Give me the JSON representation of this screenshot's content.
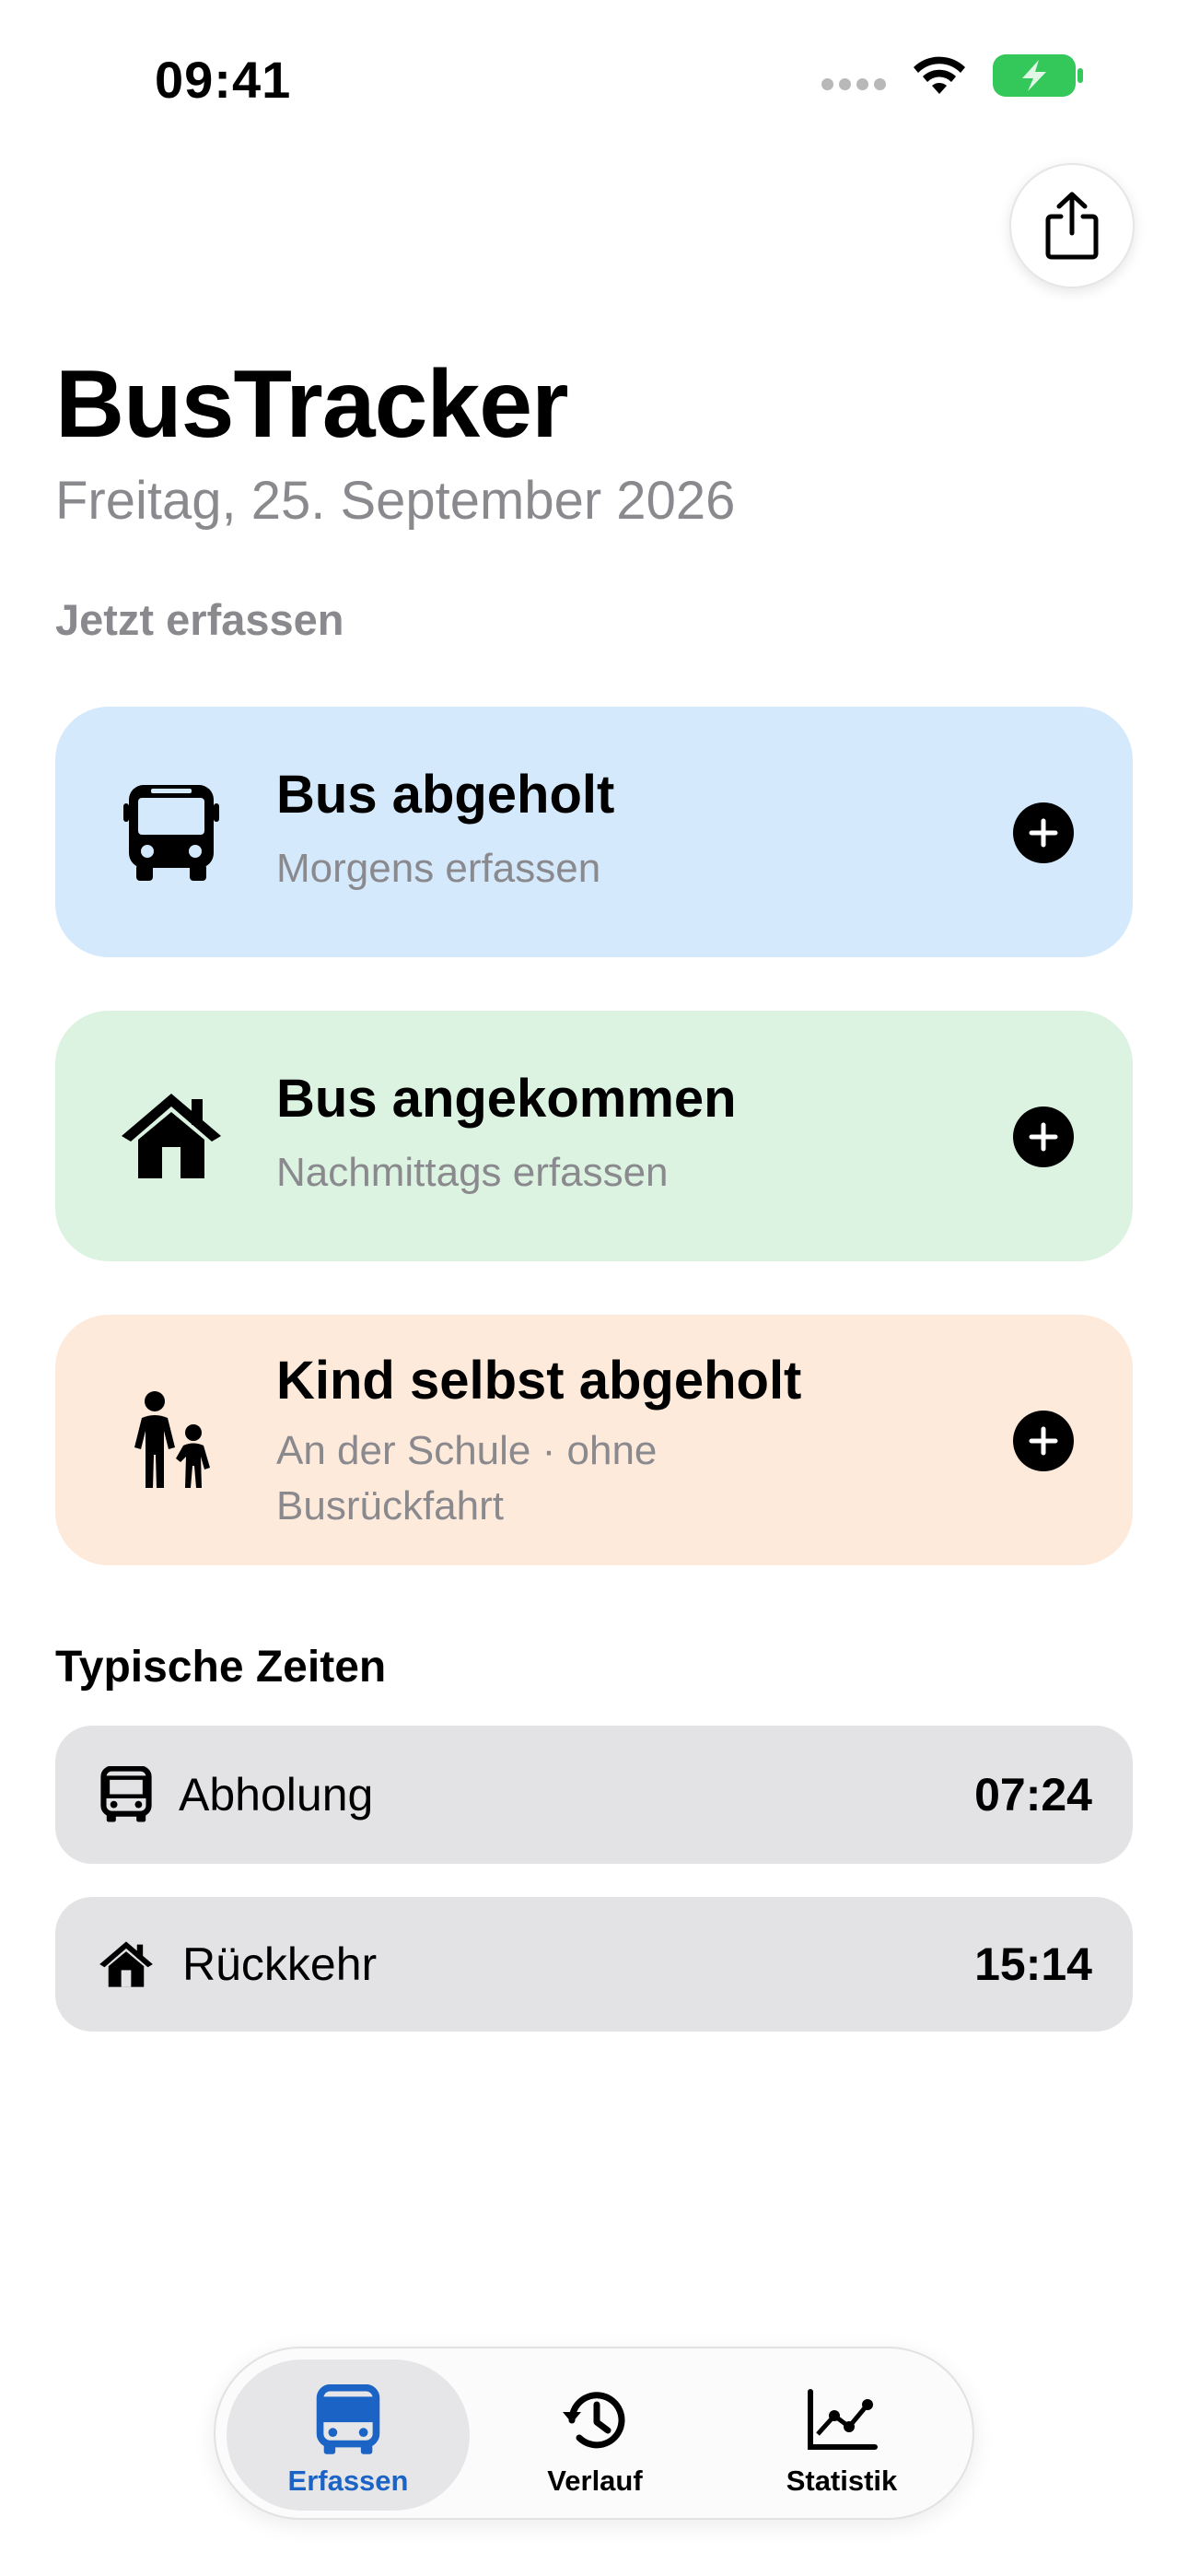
{
  "status_bar": {
    "time": "09:41"
  },
  "header": {
    "title": "BusTracker",
    "date": "Freitag, 25. September 2026",
    "share_icon": "share-icon"
  },
  "section_label": "Jetzt erfassen",
  "cards": [
    {
      "title": "Bus abgeholt",
      "subtitle": "Morgens erfassen",
      "icon": "bus-icon",
      "color": "#d5e9fc"
    },
    {
      "title": "Bus angekommen",
      "subtitle": "Nachmittags erfassen",
      "icon": "house-icon",
      "color": "#dcf3e1"
    },
    {
      "title": "Kind selbst abgeholt",
      "subtitle": "An der Schule · ohne Busrückfahrt",
      "icon": "parent-child-icon",
      "color": "#fdeadb"
    }
  ],
  "typical_times": {
    "heading": "Typische Zeiten",
    "rows": [
      {
        "label": "Abholung",
        "value": "07:24",
        "icon": "bus-icon"
      },
      {
        "label": "Rückkehr",
        "value": "15:14",
        "icon": "house-icon"
      }
    ]
  },
  "tabbar": {
    "tabs": [
      {
        "label": "Erfassen",
        "icon": "bus-icon",
        "active": true,
        "color": "#1c63c6"
      },
      {
        "label": "Verlauf",
        "icon": "history-icon",
        "active": false,
        "color": "#000000"
      },
      {
        "label": "Statistik",
        "icon": "chart-icon",
        "active": false,
        "color": "#000000"
      }
    ]
  }
}
